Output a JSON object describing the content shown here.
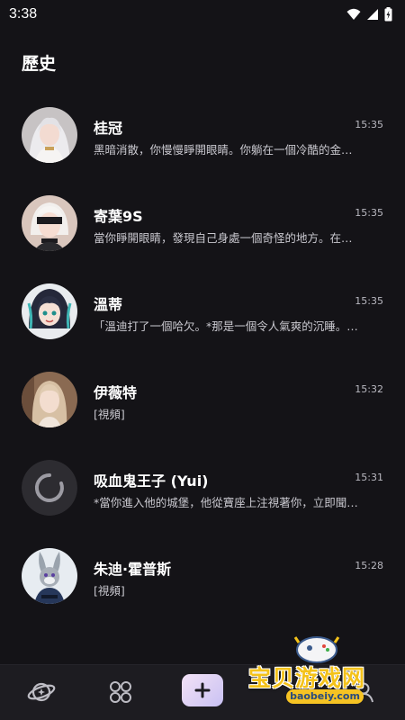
{
  "status_bar": {
    "time": "3:38"
  },
  "header": {
    "title": "歷史"
  },
  "chats": [
    {
      "name": "桂冠",
      "time": "15:35",
      "preview": "黑暗消散，你慢慢睜開眼睛。你躺在一個冷酷的金…",
      "avatar": "white-haired-girl-avatar"
    },
    {
      "name": "寄葉9S",
      "time": "15:35",
      "preview": "當你睜開眼睛，發現自己身處一個奇怪的地方。在…",
      "avatar": "blindfolded-boy-avatar"
    },
    {
      "name": "溫蒂",
      "time": "15:35",
      "preview": "「溫迪打了一個哈欠。*那是一個令人氣爽的沉睡。…",
      "avatar": "dark-haired-bard-avatar"
    },
    {
      "name": "伊薇特",
      "time": "15:32",
      "preview": "[視頻]",
      "avatar": "blonde-girl-avatar"
    },
    {
      "name": "吸血鬼王子 (Yui)",
      "time": "15:31",
      "preview": "*當你進入他的城堡，他從寶座上注視著你，立即聞…",
      "avatar": "loading-spinner"
    },
    {
      "name": "朱迪·霍普斯",
      "time": "15:28",
      "preview": "[視頻]",
      "avatar": "bunny-officer-avatar"
    }
  ],
  "bottom_nav": {
    "items": [
      "planet-icon",
      "grid-icon",
      "plus-icon",
      "profile-icon"
    ]
  },
  "watermark": {
    "text": "宝贝游戏网",
    "url": "baobeiy.com"
  },
  "colors": {
    "background": "#141317",
    "nav_background": "#1d1c21",
    "create_gradient_start": "#f3e2f6",
    "create_gradient_end": "#c9c1f3"
  }
}
